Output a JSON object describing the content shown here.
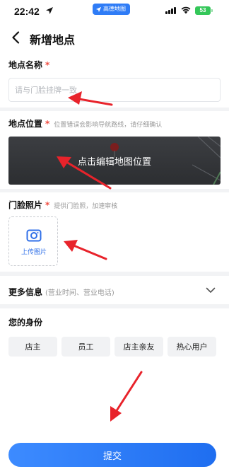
{
  "status_bar": {
    "time": "22:42",
    "app_badge": "高德地图",
    "battery": "53"
  },
  "header": {
    "title": "新增地点"
  },
  "place_name": {
    "label": "地点名称",
    "required_mark": "*",
    "placeholder": "请与门脸挂牌一致",
    "value": ""
  },
  "location": {
    "label": "地点位置",
    "required_mark": "*",
    "hint": "位置错误会影响导航路线，请仔细确认",
    "map_action": "点击编辑地图位置"
  },
  "storefront_photo": {
    "label": "门脸照片",
    "required_mark": "*",
    "hint": "提供门脸照，加速审核",
    "upload_label": "上传图片"
  },
  "more_info": {
    "label": "更多信息",
    "hint": "(营业时间、营业电话)"
  },
  "identity": {
    "label": "您的身份",
    "options": [
      "店主",
      "员工",
      "店主亲友",
      "热心用户"
    ]
  },
  "submit": {
    "label": "提交"
  },
  "colors": {
    "accent": "#1f6ef0",
    "required": "#f04a3e",
    "annotation_arrow": "#e8232b"
  },
  "icons": [
    "location-arrow-icon",
    "wifi-icon",
    "back-arrow-icon",
    "map-pin-icon",
    "camera-icon",
    "chevron-down-icon"
  ]
}
